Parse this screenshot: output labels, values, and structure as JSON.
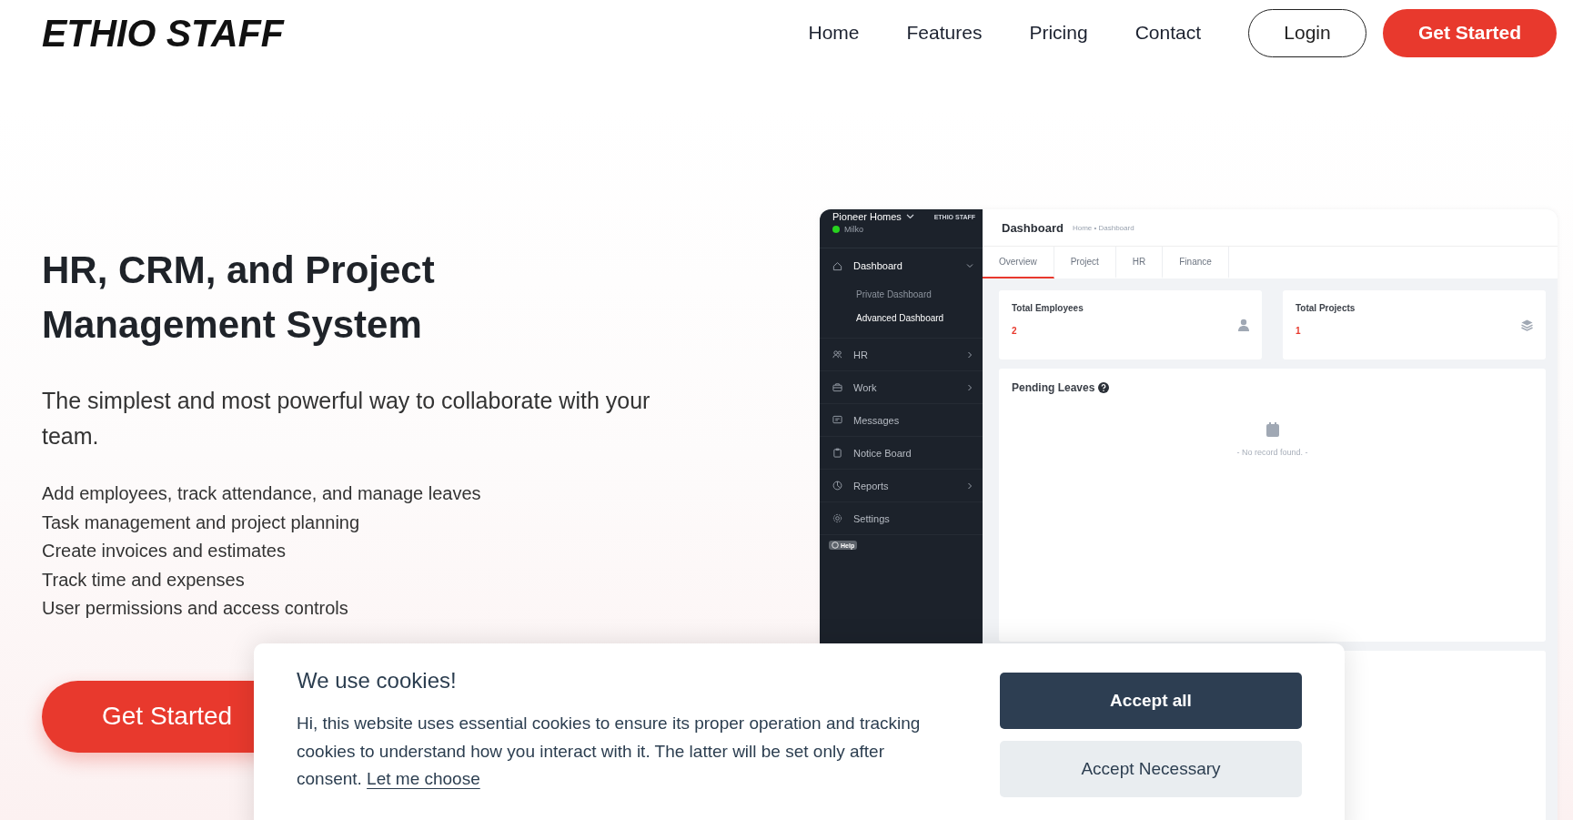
{
  "header": {
    "logo": "ETHIO STAFF",
    "nav": [
      {
        "label": "Home"
      },
      {
        "label": "Features"
      },
      {
        "label": "Pricing"
      },
      {
        "label": "Contact"
      }
    ],
    "login": "Login",
    "cta": "Get Started"
  },
  "hero": {
    "title": "HR, CRM, and Project Management System",
    "subtitle": "The simplest and most powerful way to collaborate with your team.",
    "features": [
      "Add employees, track attendance, and manage leaves",
      "Task management and project planning",
      "Create invoices and estimates",
      "Track time and expenses",
      "User permissions and access controls"
    ],
    "cta": "Get Started"
  },
  "dashboard": {
    "company": "Pioneer Homes",
    "user": "Milko",
    "brand": "ETHIO STAFF",
    "sidebar": [
      {
        "label": "Dashboard",
        "kind": "menu",
        "expanded": true,
        "children": [
          {
            "label": "Private Dashboard",
            "selected": false
          },
          {
            "label": "Advanced Dashboard",
            "selected": true
          }
        ]
      },
      {
        "label": "HR",
        "kind": "menu",
        "expanded": false
      },
      {
        "label": "Work",
        "kind": "menu",
        "expanded": false
      },
      {
        "label": "Messages",
        "kind": "link"
      },
      {
        "label": "Notice Board",
        "kind": "link"
      },
      {
        "label": "Reports",
        "kind": "menu",
        "expanded": false
      },
      {
        "label": "Settings",
        "kind": "link"
      }
    ],
    "help": "Help",
    "page_title": "Dashboard",
    "breadcrumb": "Home • Dashboard",
    "tabs": [
      {
        "label": "Overview",
        "selected": true
      },
      {
        "label": "Project",
        "selected": false
      },
      {
        "label": "HR",
        "selected": false
      },
      {
        "label": "Finance",
        "selected": false
      }
    ],
    "stats": [
      {
        "label": "Total Employees",
        "value": "2"
      },
      {
        "label": "Total Projects",
        "value": "1"
      }
    ],
    "pending": {
      "title": "Pending Leaves",
      "empty": "- No record found. -"
    }
  },
  "cookie": {
    "title": "We use cookies!",
    "text": "Hi, this website uses essential cookies to ensure its proper operation and tracking cookies to understand how you interact with it. The latter will be set only after consent.",
    "link": "Let me choose",
    "buttons": [
      {
        "label": "Accept all",
        "kind": "primary"
      },
      {
        "label": "Accept Necessary",
        "kind": "secondary"
      }
    ]
  }
}
